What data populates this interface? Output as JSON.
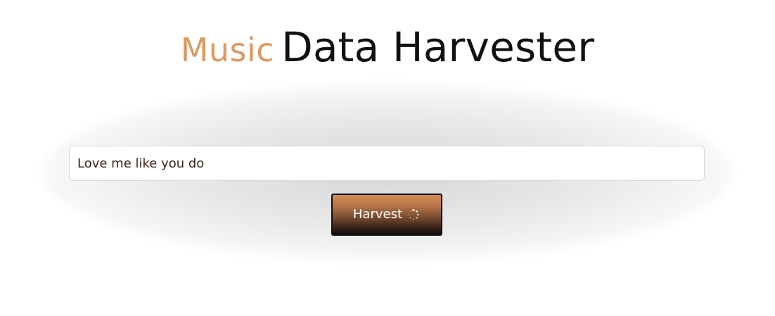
{
  "header": {
    "accent_title": "Music",
    "main_title": "Data Harvester"
  },
  "search": {
    "value": "Love me like you do"
  },
  "action": {
    "button_label": "Harvest",
    "loading_icon": "spinner-icon"
  },
  "colors": {
    "accent": "#d99a63",
    "title_text": "#111111",
    "input_text": "#3a2418",
    "button_text": "#ffffff"
  }
}
